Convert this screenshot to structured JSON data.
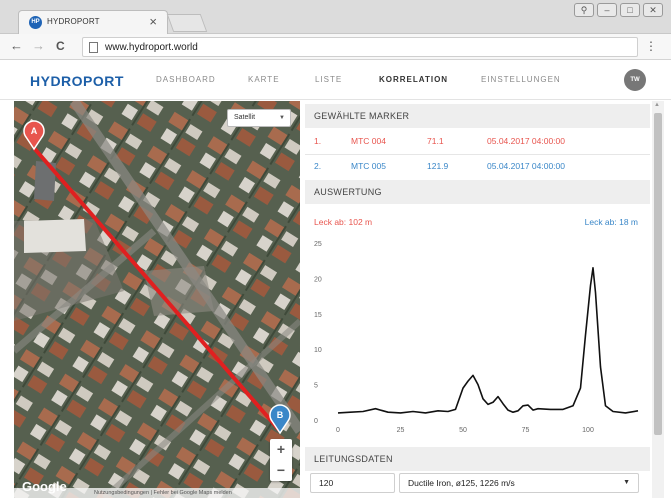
{
  "browser": {
    "tab_title": "HYDROPORT",
    "tab_close": "×",
    "favicon_text": "HP",
    "url": "www.hydroport.world",
    "window_controls": [
      "⚲",
      "–",
      "□",
      "✕"
    ],
    "back": "←",
    "forward": "→",
    "reload": "C",
    "menu": "⋮"
  },
  "app": {
    "brand": "HYDROPORT",
    "nav": [
      "DASHBOARD",
      "KARTE",
      "LISTE",
      "KORRELATION",
      "EINSTELLUNGEN"
    ],
    "active_nav": "KORRELATION",
    "avatar": "TW"
  },
  "map": {
    "type_select": "Satellit",
    "marker_a": "A",
    "marker_b": "B",
    "zoom_in": "+",
    "zoom_out": "−",
    "google": "Google",
    "attribution": "Nutzungsbedingungen | Fehler bei Google Maps melden",
    "line_color": "#e02020"
  },
  "markers": {
    "heading": "GEWÄHLTE MARKER",
    "rows": [
      {
        "index": "1.",
        "name": "MTC 004",
        "value": "71.1",
        "time": "05.04.2017 04:00:00",
        "color": "#e8554e"
      },
      {
        "index": "2.",
        "name": "MTC 005",
        "value": "121.9",
        "time": "05.04.2017 04:00:00",
        "color": "#3a87c8"
      }
    ]
  },
  "evaluation": {
    "heading": "AUSWERTUNG",
    "leak_a": "Leck ab: 102 m",
    "leak_b": "Leck ab: 18 m"
  },
  "chart_data": {
    "type": "line",
    "title": "",
    "xlabel": "",
    "ylabel": "",
    "xlim": [
      0,
      120
    ],
    "ylim": [
      0,
      25
    ],
    "x_ticks": [
      0,
      25,
      50,
      75,
      100
    ],
    "y_ticks": [
      0,
      5,
      10,
      15,
      20,
      25
    ],
    "grid": false,
    "series": [
      {
        "x": [
          0,
          5,
          10,
          15,
          20,
          25,
          30,
          35,
          40,
          44,
          47,
          50,
          52,
          54,
          56,
          58,
          60,
          62,
          64,
          66,
          68,
          70,
          72,
          74,
          76,
          78,
          80,
          85,
          90,
          94,
          97,
          99,
          101,
          102,
          103,
          105,
          107,
          110,
          115,
          120
        ],
        "y": [
          1,
          1.1,
          1.2,
          1.6,
          1.1,
          1,
          1.2,
          1,
          1.3,
          1.2,
          1.5,
          4.5,
          5.5,
          6.3,
          5,
          3,
          2.2,
          2.5,
          3.3,
          2.3,
          1.4,
          1.1,
          1.3,
          2,
          2.1,
          1.4,
          1.6,
          1.5,
          1.5,
          2,
          4.5,
          12,
          19,
          21.5,
          18,
          7.5,
          2,
          1.2,
          1,
          1.3
        ]
      }
    ]
  },
  "pipe": {
    "heading": "LEITUNGSDATEN",
    "length": "120",
    "material": "Ductile Iron, ø125, 1226 m/s"
  }
}
